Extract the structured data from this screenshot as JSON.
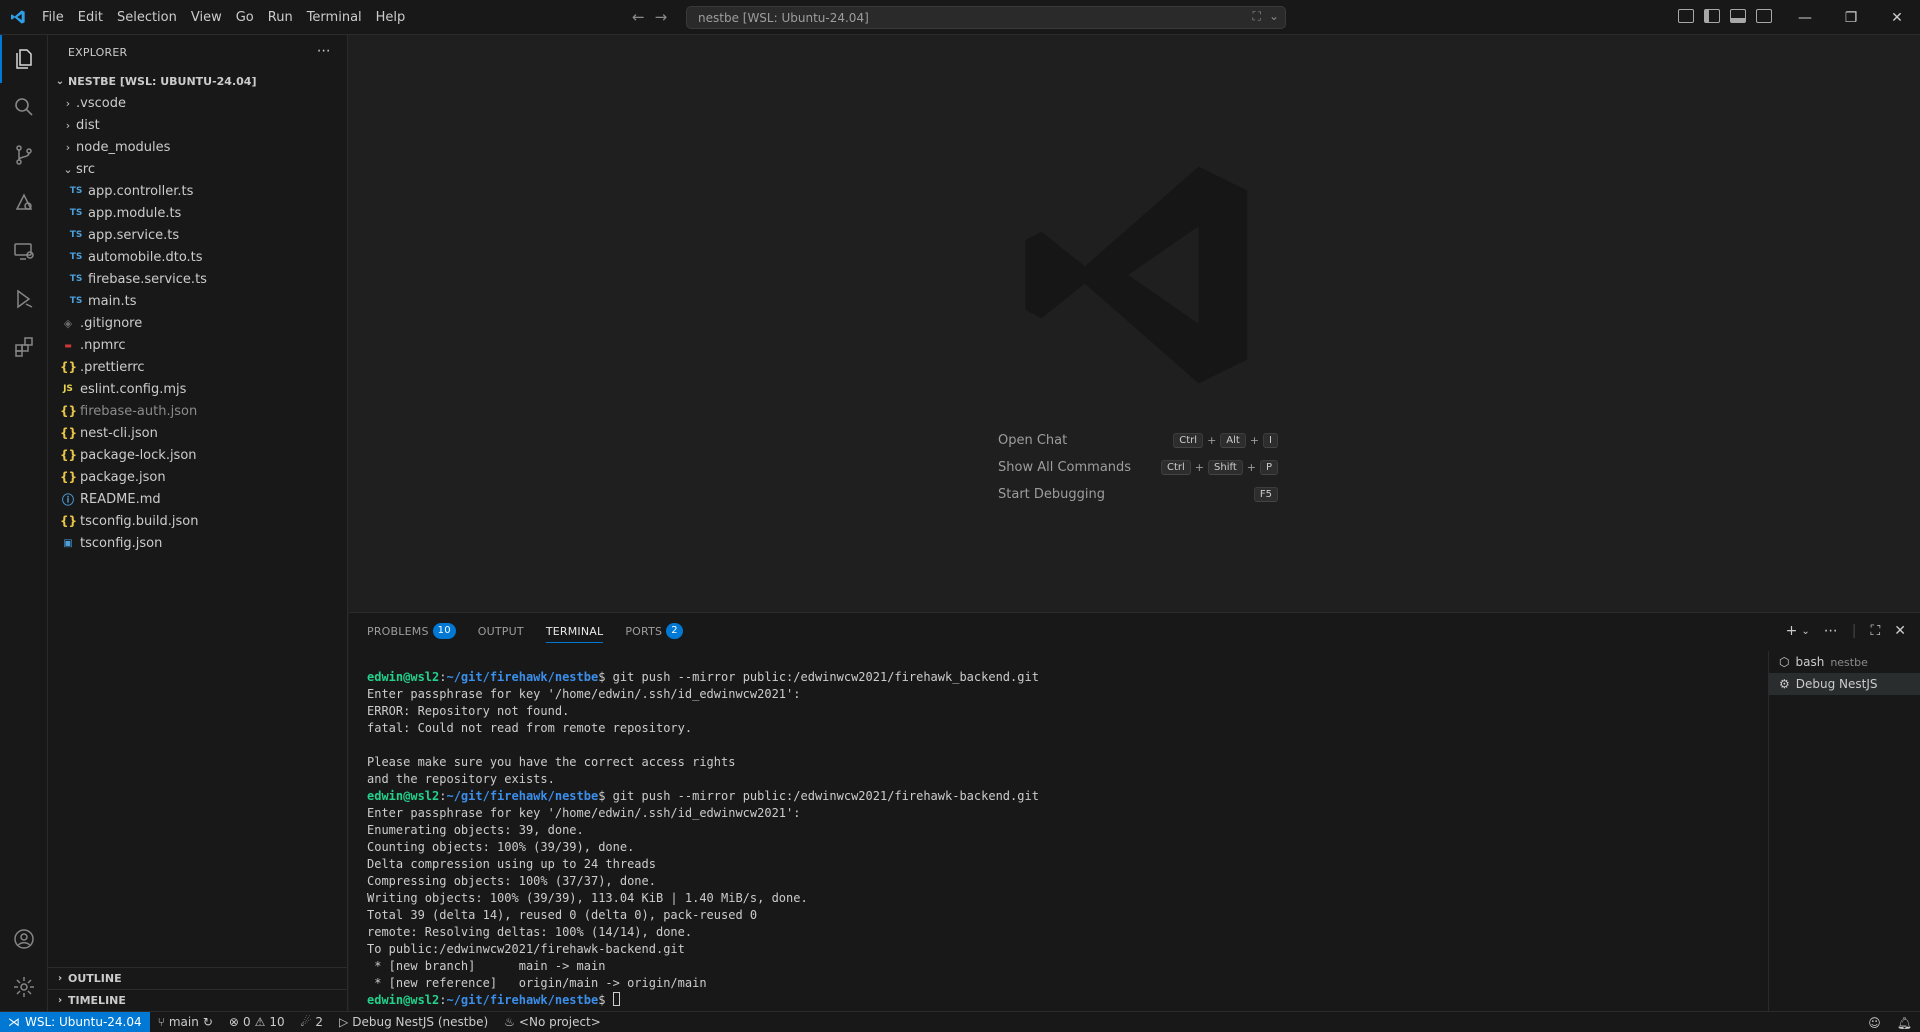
{
  "titlebar": {
    "menu": [
      "File",
      "Edit",
      "Selection",
      "View",
      "Go",
      "Run",
      "Terminal",
      "Help"
    ],
    "command_center": "nestbe [WSL: Ubuntu-24.04]"
  },
  "sidebar": {
    "title": "EXPLORER",
    "root_label": "NESTBE [WSL: UBUNTU-24.04]",
    "items": [
      {
        "label": ".vscode",
        "kind": "folder",
        "icon": "chevron-right-icon"
      },
      {
        "label": "dist",
        "kind": "folder",
        "icon": "chevron-right-icon"
      },
      {
        "label": "node_modules",
        "kind": "folder",
        "icon": "chevron-right-icon"
      },
      {
        "label": "src",
        "kind": "folder-open",
        "icon": "chevron-down-icon"
      },
      {
        "label": "app.controller.ts",
        "kind": "ts",
        "icon_text": "TS"
      },
      {
        "label": "app.module.ts",
        "kind": "ts",
        "icon_text": "TS"
      },
      {
        "label": "app.service.ts",
        "kind": "ts",
        "icon_text": "TS"
      },
      {
        "label": "automobile.dto.ts",
        "kind": "ts",
        "icon_text": "TS"
      },
      {
        "label": "firebase.service.ts",
        "kind": "ts",
        "icon_text": "TS"
      },
      {
        "label": "main.ts",
        "kind": "ts",
        "icon_text": "TS"
      },
      {
        "label": ".gitignore",
        "kind": "git"
      },
      {
        "label": ".npmrc",
        "kind": "npm"
      },
      {
        "label": ".prettierrc",
        "kind": "json",
        "icon_text": "{}"
      },
      {
        "label": "eslint.config.mjs",
        "kind": "js",
        "icon_text": "JS"
      },
      {
        "label": "firebase-auth.json",
        "kind": "json",
        "icon_text": "{}",
        "dim": true
      },
      {
        "label": "nest-cli.json",
        "kind": "json",
        "icon_text": "{}"
      },
      {
        "label": "package-lock.json",
        "kind": "json",
        "icon_text": "{}"
      },
      {
        "label": "package.json",
        "kind": "json",
        "icon_text": "{}"
      },
      {
        "label": "README.md",
        "kind": "info"
      },
      {
        "label": "tsconfig.build.json",
        "kind": "json",
        "icon_text": "{}"
      },
      {
        "label": "tsconfig.json",
        "kind": "tsconf"
      }
    ],
    "outline_label": "OUTLINE",
    "timeline_label": "TIMELINE"
  },
  "editor": {
    "shortcuts": [
      {
        "label": "Open Chat",
        "keys": [
          "Ctrl",
          "Alt",
          "I"
        ]
      },
      {
        "label": "Show All Commands",
        "keys": [
          "Ctrl",
          "Shift",
          "P"
        ]
      },
      {
        "label": "Start Debugging",
        "keys": [
          "F5"
        ]
      }
    ]
  },
  "panel": {
    "tabs": {
      "problems": "PROBLEMS",
      "problems_count": "10",
      "output": "OUTPUT",
      "terminal": "TERMINAL",
      "ports": "PORTS",
      "ports_count": "2"
    },
    "terminal_lines": [
      {
        "type": "prompt",
        "user": "edwin@wsl2",
        "path": "~/git/firehawk/nestbe",
        "cmd": " git push --mirror public:/edwinwcw2021/firehawk_backend.git"
      },
      {
        "type": "out",
        "text": "Enter passphrase for key '/home/edwin/.ssh/id_edwinwcw2021':"
      },
      {
        "type": "out",
        "text": "ERROR: Repository not found."
      },
      {
        "type": "out",
        "text": "fatal: Could not read from remote repository."
      },
      {
        "type": "out",
        "text": ""
      },
      {
        "type": "out",
        "text": "Please make sure you have the correct access rights"
      },
      {
        "type": "out",
        "text": "and the repository exists."
      },
      {
        "type": "prompt",
        "user": "edwin@wsl2",
        "path": "~/git/firehawk/nestbe",
        "cmd": " git push --mirror public:/edwinwcw2021/firehawk-backend.git"
      },
      {
        "type": "out",
        "text": "Enter passphrase for key '/home/edwin/.ssh/id_edwinwcw2021':"
      },
      {
        "type": "out",
        "text": "Enumerating objects: 39, done."
      },
      {
        "type": "out",
        "text": "Counting objects: 100% (39/39), done."
      },
      {
        "type": "out",
        "text": "Delta compression using up to 24 threads"
      },
      {
        "type": "out",
        "text": "Compressing objects: 100% (37/37), done."
      },
      {
        "type": "out",
        "text": "Writing objects: 100% (39/39), 113.04 KiB | 1.40 MiB/s, done."
      },
      {
        "type": "out",
        "text": "Total 39 (delta 14), reused 0 (delta 0), pack-reused 0"
      },
      {
        "type": "out",
        "text": "remote: Resolving deltas: 100% (14/14), done."
      },
      {
        "type": "out",
        "text": "To public:/edwinwcw2021/firehawk-backend.git"
      },
      {
        "type": "out",
        "text": " * [new branch]      main -> main"
      },
      {
        "type": "out",
        "text": " * [new reference]   origin/main -> origin/main"
      },
      {
        "type": "prompt",
        "user": "edwin@wsl2",
        "path": "~/git/firehawk/nestbe",
        "cmd": " ",
        "cursor": true
      }
    ],
    "terminals": [
      {
        "name": "bash",
        "sub": "nestbe"
      },
      {
        "name": "Debug NestJS",
        "sub": ""
      }
    ]
  },
  "statusbar": {
    "remote": "WSL: Ubuntu-24.04",
    "branch": "main",
    "errors": "0",
    "warnings": "10",
    "ports": "2",
    "debug": "Debug NestJS (nestbe)",
    "project": "<No project>"
  }
}
